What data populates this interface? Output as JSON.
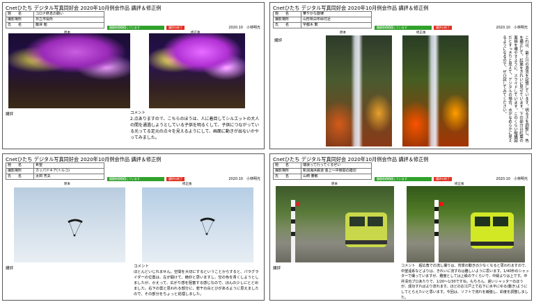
{
  "sheets": [
    {
      "header": "Cnetひたち デジタル写真同好会 2020年10月例会作品 講評＆修正例",
      "meta": [
        {
          "k": "題　　名",
          "v": "コロナ終息の願い"
        },
        {
          "k": "撮影場所",
          "v": "日立市役所"
        },
        {
          "k": "氏　　名",
          "v": "藤澤 勉"
        }
      ],
      "green_pill": "画面を再利用しています",
      "green_pill2": "〇〇〇〇〇〇",
      "red_pill": "講評の終了",
      "byline": "2020.10　小林明光",
      "original_label": "原本",
      "revised_label": "修正後",
      "kohyo_label": "講評",
      "comment_title": "コメント",
      "comment": "2.点ありますので、こちらのほうは、人に着目してシルエットの大人の間を通過しようとしている子供を明るくして、子供につながっている光ってる足元の点々を見えるようにして、画面に動きが出ないかやってみました。"
    },
    {
      "header": "Cnetひたち デジタル写真同好会 2020年10月例会作品 講評＆修正例",
      "meta": [
        {
          "k": "題　　名",
          "v": "華やかな旋律"
        },
        {
          "k": "撮影場所",
          "v": "山形県白布峠付近"
        },
        {
          "k": "氏　　名",
          "v": "宇都木 勲"
        }
      ],
      "green_pill": "画面を再利用しています",
      "green_pill2": "〇〇〇〇〇〇",
      "red_pill": "講評の終了",
      "byline": "2020.10　小林明光",
      "original_label": "原本",
      "revised_label": "修正後",
      "kohyo_label": "講評",
      "comment_title": "コメント",
      "comment": "これは、最上川の源流を記憶しています。明るさを調整し、色を補正して、紅葉をきれいに見せています。下の部分は紅葉の面積を増やすように、スライドしています。このくらい縦構図だとすっきりと見えて、デジタルの場合、水がなめらかに見えるようになるので、ぜひ試してみてください。"
    },
    {
      "header": "Cnetひたち デジタル写真同好会 2020年10月例会作品 講評＆修正例",
      "meta": [
        {
          "k": "題　　名",
          "v": "希望"
        },
        {
          "k": "撮影場所",
          "v": "カッパドキア(トルコ)"
        },
        {
          "k": "氏　　名",
          "v": "太田 芳夫"
        }
      ],
      "green_pill": "画面を再利用しています",
      "green_pill2": "〇〇〇〇〇〇",
      "red_pill": "講評の終了",
      "byline": "2020.10　小林明光",
      "original_label": "原本",
      "revised_label": "修正後",
      "kohyo_label": "講評",
      "comment_title": "コメント",
      "comment": "ほとんどいじれません。空間を大切にするということからすると、パラグライダーの位置は、左が開けて、絶妙と思いますし、空の色を青くしようとしましたが、かえって、広がり感を阻害する感じなので、ほんの少しにとどめました。右下の雲と思われる部分に、若干の白とびがあるように思えましたので、その部分をちょっと処理しました。"
    },
    {
      "header": "Cnetひたち デジタル写真同好会 2020年10月例会作品 講評＆修正例",
      "meta": [
        {
          "k": "題　　名",
          "v": "瑞浪って行ってくるぜい"
        },
        {
          "k": "撮影場所",
          "v": "新潟海浜鉄道 金上～中條間の踏切"
        },
        {
          "k": "氏　　名",
          "v": "山崎 勝敏"
        }
      ],
      "green_pill": "画面を再利用しています",
      "green_pill2": "〇〇〇〇〇〇",
      "red_pill": "講評の終了",
      "byline": "2020.10　小林明光",
      "original_label": "原本",
      "revised_label": "修正後",
      "kohyo_label": "講評",
      "comment_title": "コメント",
      "comment": "コメント　超広角での流し撮りは、背景の動きの少なくなると思われますので、中望遠系などよりは、きれいに流すのは難しいように思います。1/40秒のシャッターで撮っていますが、難度としては上級の下くらいで、中級よりは上です。中井清也プロあたりで、1/20～1/30ですね。もちろん、遅いシャッターのほうが、成功すればより流れます。ほどのお江戸上で右下に水平にゆる(動き)ようにしてとらえたいと思います。今回は、ソフトで流れを補強し、彩度を調整しました。"
    }
  ]
}
